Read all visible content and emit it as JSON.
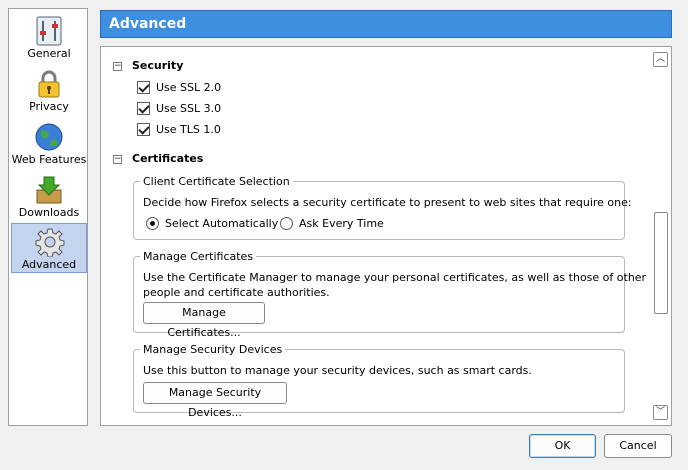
{
  "sidebar": {
    "items": [
      {
        "label": "General",
        "icon": "general-icon"
      },
      {
        "label": "Privacy",
        "icon": "lock-icon"
      },
      {
        "label": "Web Features",
        "icon": "globe-icon"
      },
      {
        "label": "Downloads",
        "icon": "download-icon"
      },
      {
        "label": "Advanced",
        "icon": "gear-icon",
        "selected": true
      }
    ]
  },
  "header": {
    "title": "Advanced"
  },
  "security": {
    "title": "Security",
    "options": [
      {
        "label": "Use SSL 2.0",
        "checked": true
      },
      {
        "label": "Use SSL 3.0",
        "checked": true
      },
      {
        "label": "Use TLS 1.0",
        "checked": true
      }
    ]
  },
  "certificates": {
    "title": "Certificates",
    "client": {
      "title": "Client Certificate Selection",
      "description": "Decide how Firefox selects a security certificate to present to web sites that require one:",
      "options": [
        {
          "label": "Select Automatically",
          "selected": true
        },
        {
          "label": "Ask Every Time",
          "selected": false
        }
      ]
    },
    "manage": {
      "title": "Manage Certificates",
      "description_line1": "Use the Certificate Manager to manage your personal certificates, as well as those of other",
      "description_line2": "people and certificate authorities.",
      "button": "Manage Certificates..."
    },
    "devices": {
      "title": "Manage Security Devices",
      "description": "Use this button to manage your security devices, such as smart cards.",
      "button": "Manage Security Devices..."
    }
  },
  "footer": {
    "ok": "OK",
    "cancel": "Cancel"
  },
  "colors": {
    "header": "#3f8fe0",
    "selected": "#c5d4ee"
  }
}
